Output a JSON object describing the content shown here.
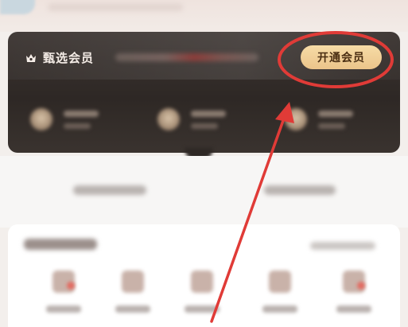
{
  "member_card": {
    "title": "甄选会员",
    "open_button_label": "开通会员"
  },
  "colors": {
    "card_bg": "#2e2825",
    "button_gold": "#f6dca6",
    "annotation_red": "#e03b37"
  }
}
